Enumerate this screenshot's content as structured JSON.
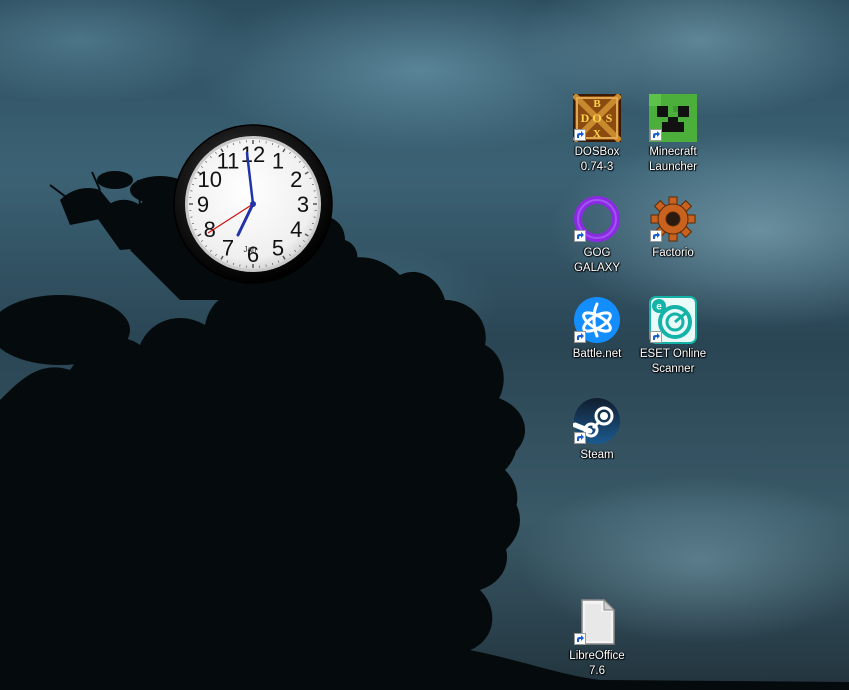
{
  "desktop": {
    "clock": {
      "numerals": [
        "12",
        "1",
        "2",
        "3",
        "4",
        "5",
        "6",
        "7",
        "8",
        "9",
        "10",
        "11"
      ],
      "brand": "Jan"
    },
    "icons": [
      {
        "id": "dosbox",
        "label": "DOSBox\n0.74-3",
        "logo_text": [
          "B",
          "D",
          "O",
          "S",
          "X"
        ]
      },
      {
        "id": "minecraft",
        "label": "Minecraft\nLauncher"
      },
      {
        "id": "gog",
        "label": "GOG GALAXY"
      },
      {
        "id": "factorio",
        "label": "Factorio"
      },
      {
        "id": "battlenet",
        "label": "Battle.net"
      },
      {
        "id": "eset",
        "label": "ESET Online\nScanner",
        "logo_text": "e"
      },
      {
        "id": "steam",
        "label": "Steam"
      },
      {
        "id": "libreoffice",
        "label": "LibreOffice\n7.6"
      }
    ]
  },
  "colors": {
    "gog_purple": "#8a2be2",
    "battlenet_blue": "#148eff",
    "eset_teal": "#14b3a7",
    "steam_navy": "#1b2838",
    "minecraft_green": "#4caf3c",
    "factorio_orange": "#c8621e"
  }
}
